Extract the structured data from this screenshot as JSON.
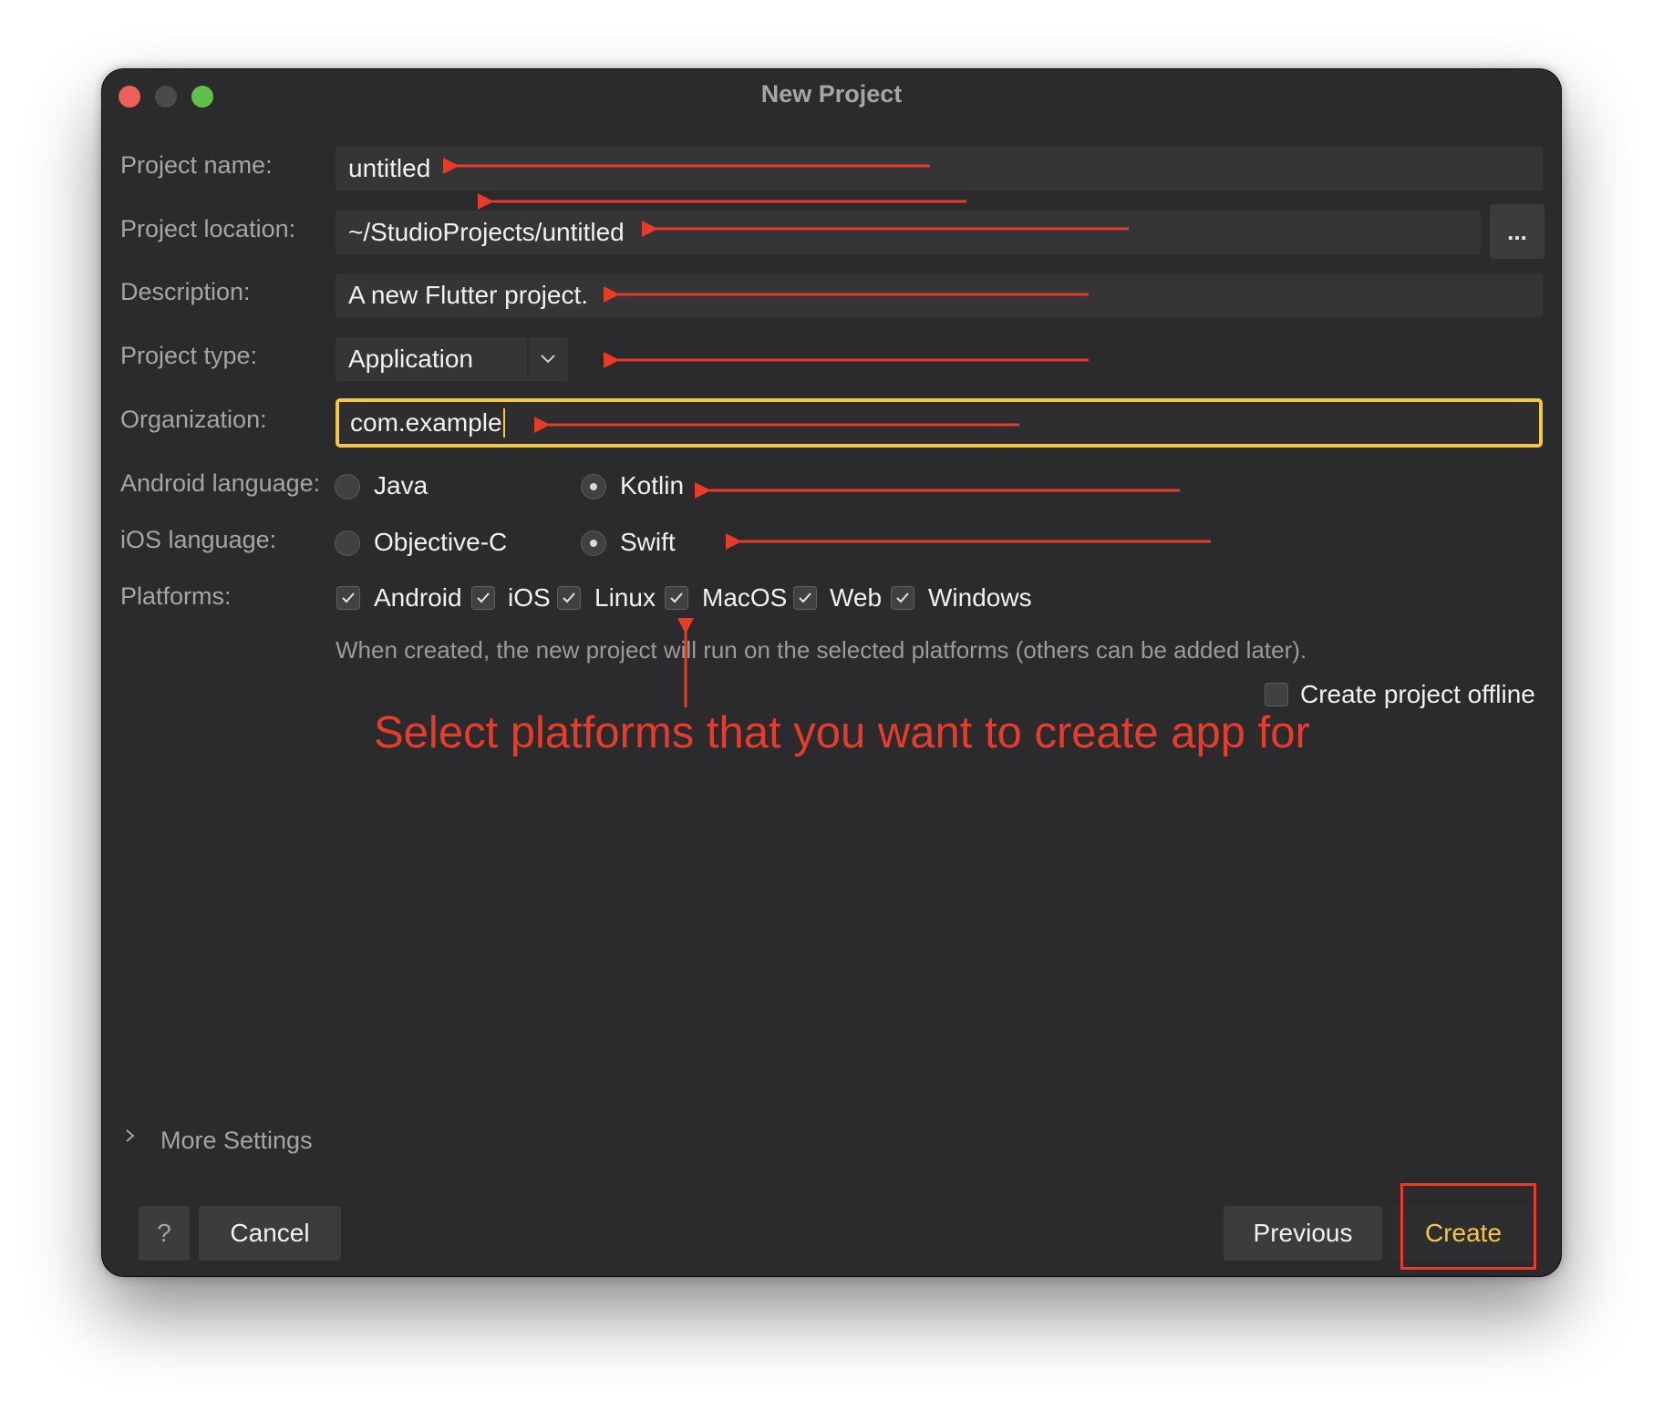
{
  "window": {
    "title": "New Project"
  },
  "form": {
    "project_name": {
      "label": "Project name:",
      "value": "untitled"
    },
    "project_location": {
      "label": "Project location:",
      "value": "~/StudioProjects/untitled",
      "browse_label": "..."
    },
    "description": {
      "label": "Description:",
      "value": "A new Flutter project."
    },
    "project_type": {
      "label": "Project type:",
      "value": "Application"
    },
    "organization": {
      "label": "Organization:",
      "value": "com.example"
    },
    "android_language": {
      "label": "Android language:",
      "options": [
        "Java",
        "Kotlin"
      ],
      "selected": "Kotlin"
    },
    "ios_language": {
      "label": "iOS language:",
      "options": [
        "Objective-C",
        "Swift"
      ],
      "selected": "Swift"
    },
    "platforms": {
      "label": "Platforms:",
      "items": [
        {
          "label": "Android",
          "checked": true
        },
        {
          "label": "iOS",
          "checked": true
        },
        {
          "label": "Linux",
          "checked": true
        },
        {
          "label": "MacOS",
          "checked": true
        },
        {
          "label": "Web",
          "checked": true
        },
        {
          "label": "Windows",
          "checked": true
        }
      ],
      "hint": "When created, the new project will run on the selected platforms (others can be added later)."
    },
    "offline": {
      "label": "Create project offline",
      "checked": false
    }
  },
  "annotation": {
    "text": "Select platforms that you want to create app for",
    "color": "#e83c2b"
  },
  "more_settings": {
    "label": "More Settings"
  },
  "footer": {
    "help_label": "?",
    "cancel_label": "Cancel",
    "previous_label": "Previous",
    "create_label": "Create"
  },
  "colors": {
    "accent": "#f5c842",
    "annotation": "#e83c2b",
    "background": "#2b2b2d",
    "field": "#353537"
  }
}
